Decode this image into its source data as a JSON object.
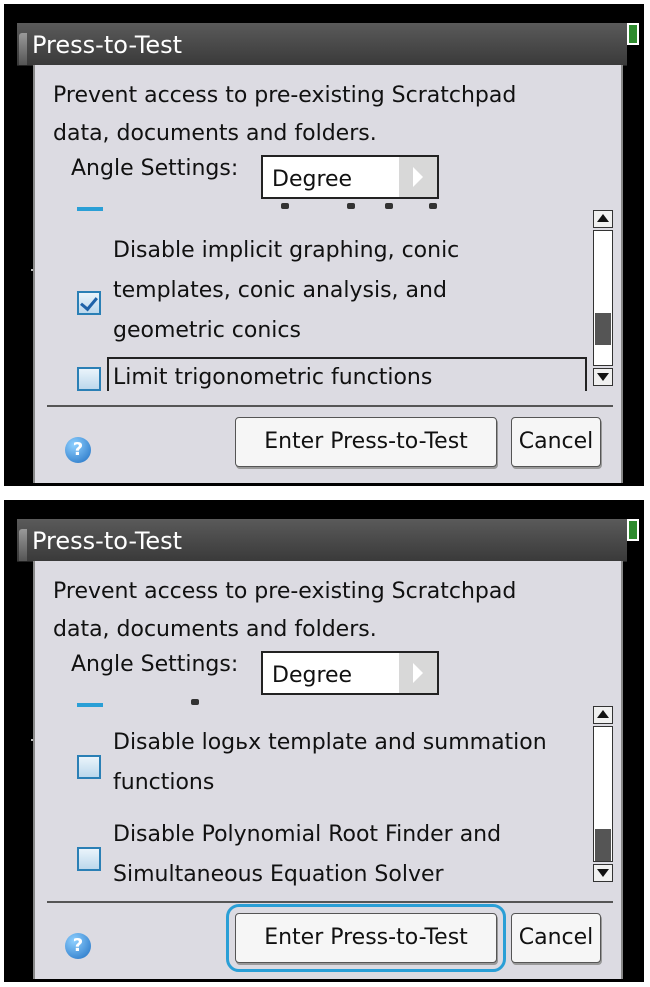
{
  "panels": [
    {
      "title": "Press-to-Test",
      "prevent_text": "Prevent access to pre-existing Scratchpad data, documents and folders.",
      "angle_label": "Angle Settings:",
      "angle_value": "Degree",
      "options": [
        {
          "label": "Disable implicit graphing, conic\ntemplates, conic analysis, and\ngeometric conics",
          "checked": true
        },
        {
          "label": "Limit trigonometric functions",
          "checked": false
        }
      ],
      "help_symbol": "?",
      "enter_button": "Enter Press-to-Test",
      "cancel_button": "Cancel",
      "scroll_position": 0.75
    },
    {
      "title": "Press-to-Test",
      "prevent_text": "Prevent access to pre-existing Scratchpad data, documents and folders.",
      "angle_label": "Angle Settings:",
      "angle_value": "Degree",
      "options": [
        {
          "label": "Disable logьx template and summation\nfunctions",
          "checked": false
        },
        {
          "label": "Disable Polynomial Root Finder and\nSimultaneous Equation Solver",
          "checked": false
        }
      ],
      "help_symbol": "?",
      "enter_button": "Enter Press-to-Test",
      "cancel_button": "Cancel",
      "scroll_position": 1.0
    }
  ],
  "colors": {
    "accent": "#2a9fd6",
    "dialog_bg": "#dcdbe2",
    "titlebar": "#454545"
  }
}
